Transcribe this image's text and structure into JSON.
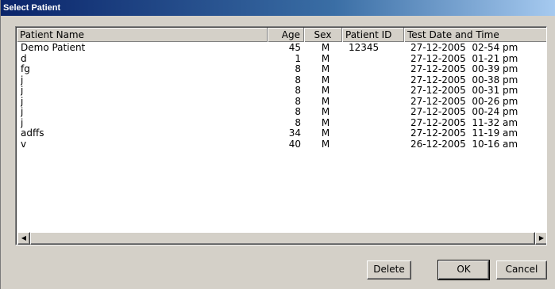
{
  "window": {
    "title": "Select Patient"
  },
  "list": {
    "columns": [
      {
        "label": "Patient Name"
      },
      {
        "label": "Age"
      },
      {
        "label": "Sex"
      },
      {
        "label": "Patient ID"
      },
      {
        "label": "Test Date and Time"
      }
    ],
    "rows": [
      {
        "name": "Demo Patient",
        "age": "45",
        "sex": "M",
        "pid": "12345",
        "datetime": "27-12-2005  02-54 pm"
      },
      {
        "name": "d",
        "age": "1",
        "sex": "M",
        "pid": "",
        "datetime": "27-12-2005  01-21 pm"
      },
      {
        "name": "fg",
        "age": "8",
        "sex": "M",
        "pid": "",
        "datetime": "27-12-2005  00-39 pm"
      },
      {
        "name": "j",
        "age": "8",
        "sex": "M",
        "pid": "",
        "datetime": "27-12-2005  00-38 pm"
      },
      {
        "name": "j",
        "age": "8",
        "sex": "M",
        "pid": "",
        "datetime": "27-12-2005  00-31 pm"
      },
      {
        "name": "j",
        "age": "8",
        "sex": "M",
        "pid": "",
        "datetime": "27-12-2005  00-26 pm"
      },
      {
        "name": "j",
        "age": "8",
        "sex": "M",
        "pid": "",
        "datetime": "27-12-2005  00-24 pm"
      },
      {
        "name": "j",
        "age": "8",
        "sex": "M",
        "pid": "",
        "datetime": "27-12-2005  11-32 am"
      },
      {
        "name": "adffs",
        "age": "34",
        "sex": "M",
        "pid": "",
        "datetime": "27-12-2005  11-19 am"
      },
      {
        "name": "v",
        "age": "40",
        "sex": "M",
        "pid": "",
        "datetime": "26-12-2005  10-16 am"
      }
    ]
  },
  "scrollbar": {
    "left_icon": "arrow-left-icon",
    "right_icon": "arrow-right-icon"
  },
  "buttons": {
    "delete": "Delete",
    "ok": "OK",
    "cancel": "Cancel"
  }
}
